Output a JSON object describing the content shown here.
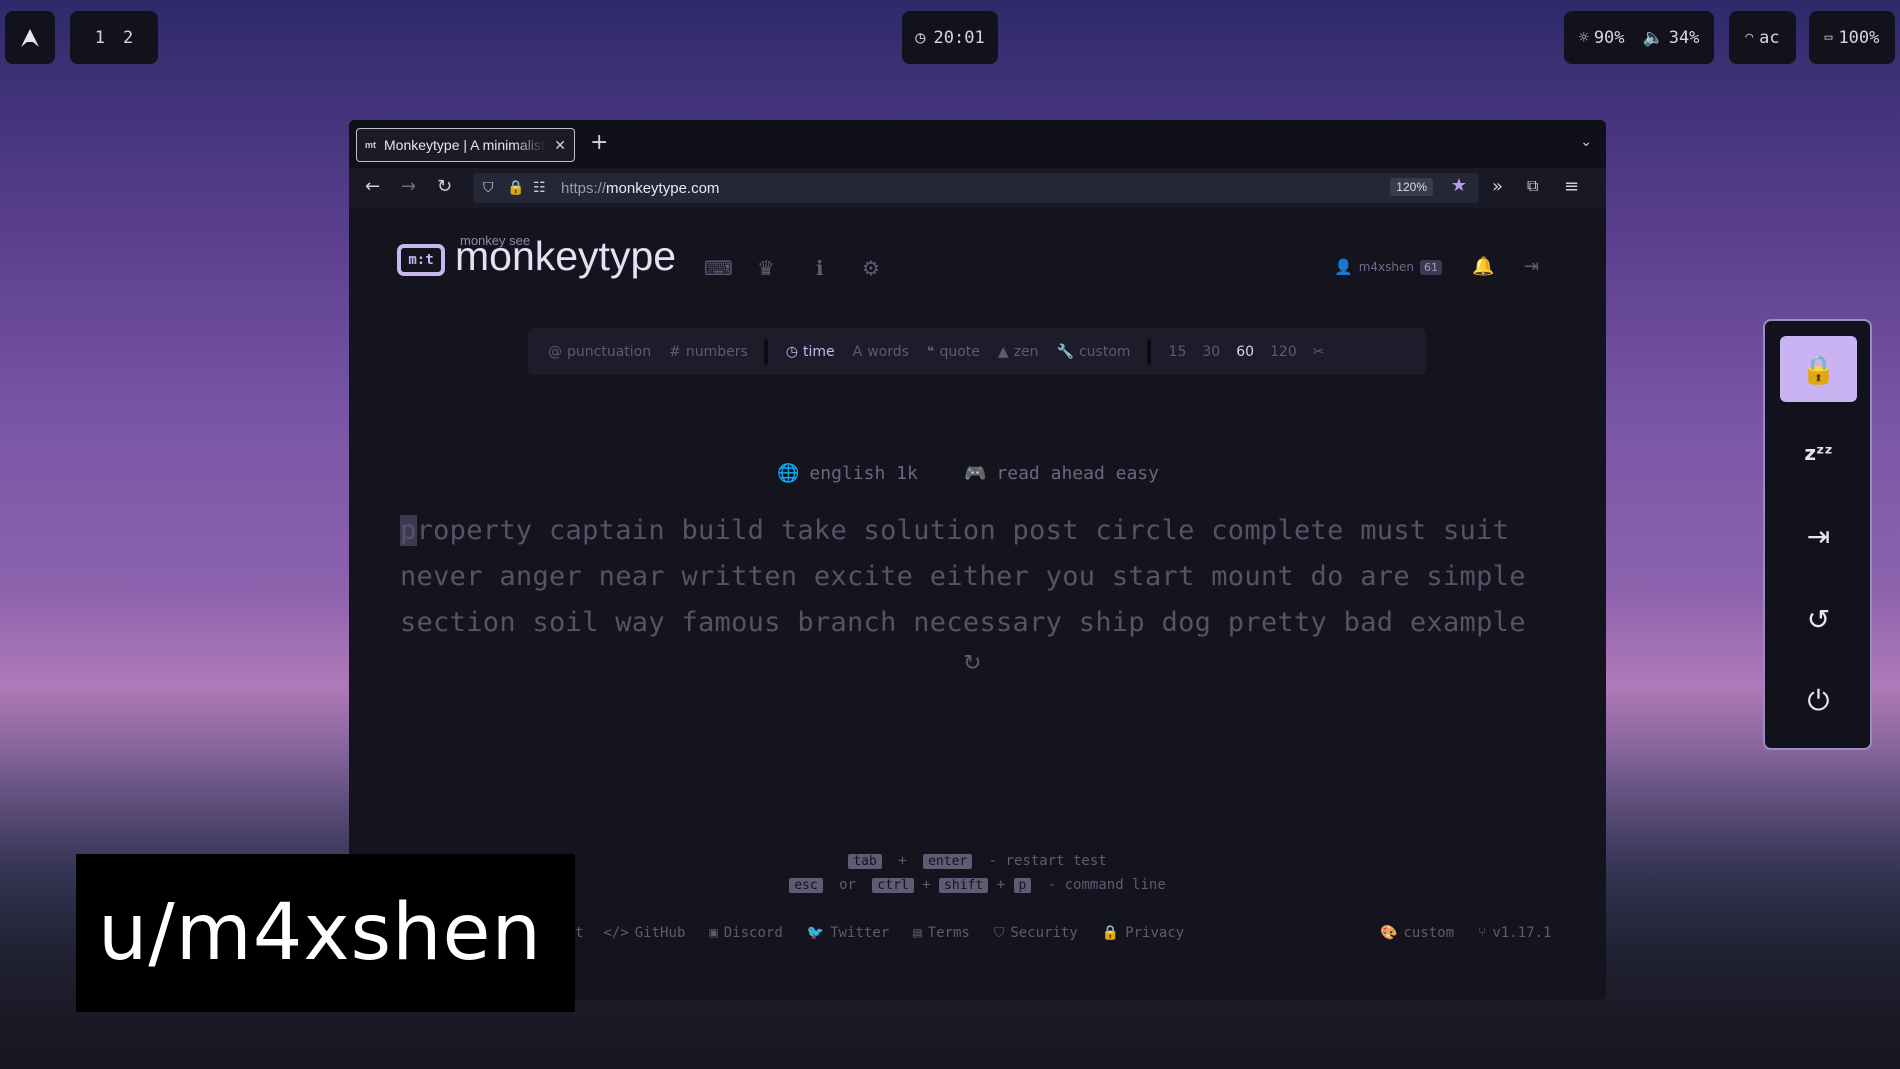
{
  "topbar": {
    "workspaces": [
      "1",
      "2"
    ],
    "clock": "20:01",
    "brightness": "90%",
    "volume": "34%",
    "network": "ac",
    "battery": "100%"
  },
  "browser": {
    "tab_title": "Monkeytype | A minimalistic",
    "url_proto": "https://",
    "url_host": "monkeytype.com",
    "zoom": "120%"
  },
  "monkeytype": {
    "logo_glyph": "m:t",
    "subtitle": "monkey see",
    "title": "monkeytype",
    "username": "m4xshen",
    "level": "61",
    "config": {
      "toggles": [
        "punctuation",
        "numbers"
      ],
      "modes": [
        "time",
        "words",
        "quote",
        "zen",
        "custom"
      ],
      "active_mode": "time",
      "durations": [
        "15",
        "30",
        "60",
        "120"
      ],
      "active_duration": "60"
    },
    "language": "english 1k",
    "funbox": "read ahead easy",
    "first_char": "p",
    "words_line1_rest": "roperty captain build take solution post circle complete must suit",
    "words_line2": "never anger near written excite either you start mount do are simple",
    "words_line3": "section soil way famous branch necessary ship dog pretty bad example",
    "hints": {
      "tab": "tab",
      "plus": "+",
      "enter": "enter",
      "restart": "- restart test",
      "esc": "esc",
      "or": "or",
      "ctrl": "ctrl",
      "shift": "shift",
      "p": "p",
      "command": "- command line"
    },
    "footer": {
      "partial": "t",
      "links": [
        "GitHub",
        "Discord",
        "Twitter",
        "Terms",
        "Security",
        "Privacy"
      ],
      "theme": "custom",
      "version": "v1.17.1"
    }
  },
  "watermark": "u/m4xshen",
  "colors": {
    "accent": "#c9b3f2",
    "bg": "#14141f",
    "sub": "#5e5b74"
  }
}
